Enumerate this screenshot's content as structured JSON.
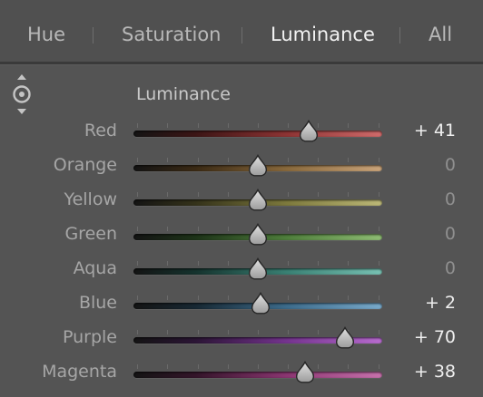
{
  "tabs": [
    {
      "label": "Hue",
      "active": false
    },
    {
      "label": "Saturation",
      "active": false
    },
    {
      "label": "Luminance",
      "active": true
    },
    {
      "label": "All",
      "active": false
    }
  ],
  "section_title": "Luminance",
  "target_tool_icon": "targeted-adjustment-icon",
  "slider_range": [
    -100,
    100
  ],
  "sliders": [
    {
      "label": "Red",
      "value": 41,
      "display": "+ 41",
      "gradient": [
        "#141414",
        "#3c1515",
        "#8e3434",
        "#d06b6b"
      ]
    },
    {
      "label": "Orange",
      "value": 0,
      "display": "0",
      "gradient": [
        "#141414",
        "#3b2a14",
        "#8a6a3d",
        "#cba57b"
      ]
    },
    {
      "label": "Yellow",
      "value": 0,
      "display": "0",
      "gradient": [
        "#141414",
        "#34321a",
        "#7e7a3d",
        "#bcb878"
      ]
    },
    {
      "label": "Green",
      "value": 0,
      "display": "0",
      "gradient": [
        "#141414",
        "#1d3318",
        "#4f7f3c",
        "#8fbd74"
      ]
    },
    {
      "label": "Aqua",
      "value": 0,
      "display": "0",
      "gradient": [
        "#141414",
        "#15332e",
        "#3a8174",
        "#78c1b3"
      ]
    },
    {
      "label": "Blue",
      "value": 2,
      "display": "+ 2",
      "gradient": [
        "#141414",
        "#172833",
        "#3d6c8c",
        "#79aacb"
      ]
    },
    {
      "label": "Purple",
      "value": 70,
      "display": "+ 70",
      "gradient": [
        "#141414",
        "#2b1535",
        "#75348f",
        "#b86ccf"
      ]
    },
    {
      "label": "Magenta",
      "value": 38,
      "display": "+ 38",
      "gradient": [
        "#141414",
        "#34152a",
        "#8c3672",
        "#c872ad"
      ]
    }
  ]
}
